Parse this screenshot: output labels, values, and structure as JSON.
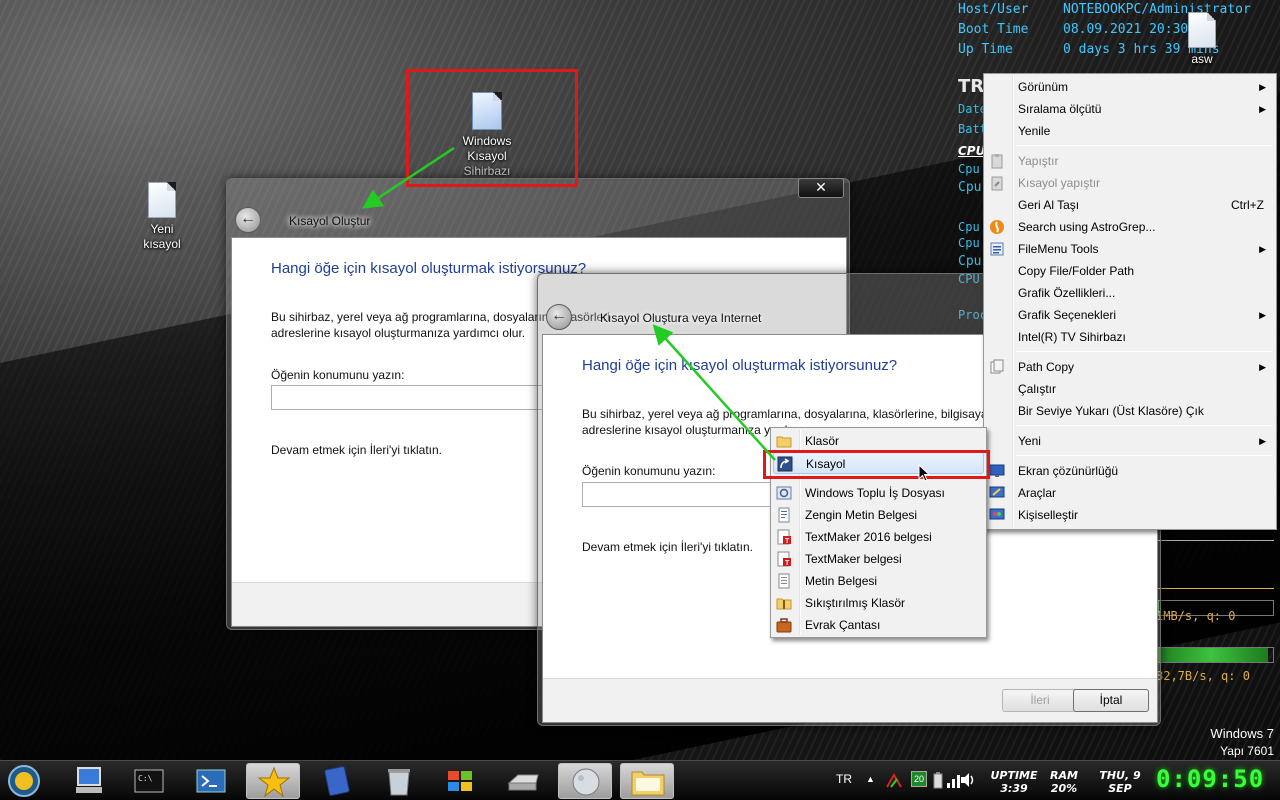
{
  "sysinfo": {
    "host_label": "Host/User",
    "host_value": "NOTEBOOKPC/Administrator",
    "boot_label": "Boot Time",
    "boot_value": "08.09.2021 20:30",
    "uptime_label": "Up Time",
    "uptime_value": "0 days 3 hrs 39 mins",
    "tr_label": "TR",
    "date_label": "Date",
    "batt_label": "Batt",
    "cpu_label": "CPU",
    "cpu_lines": [
      "Cpu",
      "Cpu",
      "Cpu",
      "Cpu",
      "Cpu",
      "CPU"
    ],
    "proc_label": "Proc",
    "net_1": "1MB/s, q: 0",
    "net_2": "82,7B/s, q: 0",
    "windows_label": "Windows 7",
    "build_label": "Yapı 7601"
  },
  "desktop_icons": {
    "asw": "asw",
    "yeni_kisayol": "Yeni\nkısayol",
    "wizard_line1": "Windows",
    "wizard_line2": "Kısayol",
    "wizard_line3": "Sihirbazı"
  },
  "dialog_back": {
    "title": "Kısayol Oluştur",
    "close_label": "✕",
    "heading": "Hangi öğe için kısayol oluşturmak istiyorsunuz?",
    "desc_line1": "Bu sihirbaz, yerel veya ağ programlarına, dosyalarına, klasörleri",
    "desc_line2": "adreslerine kısayol oluşturmanıza yardımcı olur.",
    "location_label": "Öğenin konumunu yazın:",
    "continue_text": "Devam etmek için İleri'yi tıklatın."
  },
  "dialog_front": {
    "title": "Kısayol Oluştur",
    "title_overlap": "ra veya Internet",
    "heading": "Hangi öğe için kısayol oluşturmak istiyorsunuz?",
    "desc_line1": "Bu sihirbaz, yerel veya ağ programlarına, dosyalarına, klasörlerine, bilgisayarla",
    "desc_line2": "adreslerine kısayol oluşturmanıza yardımcı o",
    "location_label": "Öğenin konumunu yazın:",
    "continue_text": "Devam etmek için İleri'yi tıklatın.",
    "next_button": "İleri",
    "cancel_button": "İptal"
  },
  "context_menu": {
    "items": [
      {
        "label": "Görünüm",
        "submenu": true
      },
      {
        "label": "Sıralama ölçütü",
        "submenu": true
      },
      {
        "label": "Yenile"
      },
      {
        "label": "Yapıştır",
        "disabled": true
      },
      {
        "label": "Kısayol yapıştır",
        "disabled": true
      },
      {
        "label": "Geri Al Taşı",
        "shortcut": "Ctrl+Z"
      },
      {
        "label": "Search using AstroGrep..."
      },
      {
        "label": "FileMenu Tools",
        "submenu": true
      },
      {
        "label": "Copy File/Folder Path"
      },
      {
        "label": "Grafik Özellikleri..."
      },
      {
        "label": "Grafik Seçenekleri",
        "submenu": true
      },
      {
        "label": "Intel(R) TV Sihirbazı"
      },
      {
        "label": "Path Copy",
        "submenu": true
      },
      {
        "label": "Çalıştır"
      },
      {
        "label": "Bir Seviye Yukarı (Üst Klasöre) Çık"
      },
      {
        "label": "Yeni",
        "submenu": true
      },
      {
        "label": "Ekran çözünürlüğü"
      },
      {
        "label": "Araçlar"
      },
      {
        "label": "Kişiselleştir"
      }
    ]
  },
  "new_submenu": {
    "items": [
      {
        "label": "Klasör"
      },
      {
        "label": "Kısayol",
        "highlighted": true
      },
      {
        "label": "Windows Toplu İş Dosyası"
      },
      {
        "label": "Zengin Metin Belgesi"
      },
      {
        "label": "TextMaker 2016 belgesi"
      },
      {
        "label": "TextMaker belgesi"
      },
      {
        "label": "Metin Belgesi"
      },
      {
        "label": "Sıkıştırılmış Klasör"
      },
      {
        "label": "Evrak Çantası"
      }
    ]
  },
  "taskbar": {
    "language": "TR",
    "up_arrow": "▲",
    "badge": "20",
    "uptime_label": "UPTIME",
    "uptime_value": "3:39",
    "ram_label": "RAM",
    "ram_value": "20%",
    "date_line1": "THU, 9",
    "date_line2": "SEP",
    "clock": "0:09:50"
  },
  "colors": {
    "highlight_box": "#e01818",
    "arrow": "#22cc22",
    "clock": "#39ff39",
    "sys_text": "#3fc8ff"
  }
}
